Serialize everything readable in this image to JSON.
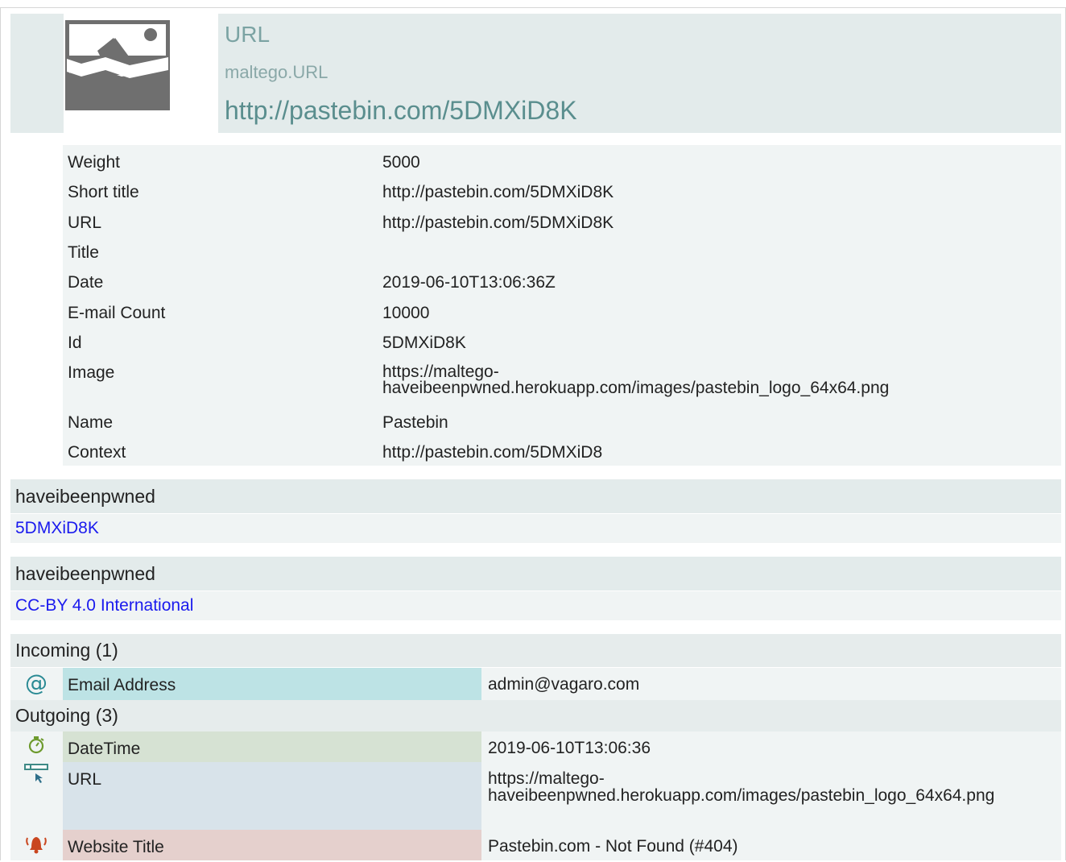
{
  "header": {
    "type_label": "URL",
    "type_id": "maltego.URL",
    "value": "http://pastebin.com/5DMXiD8K",
    "icon": "image-placeholder-icon"
  },
  "properties": [
    {
      "key": "Weight",
      "value": "5000"
    },
    {
      "key": "Short title",
      "value": "http://pastebin.com/5DMXiD8K"
    },
    {
      "key": "URL",
      "value": "http://pastebin.com/5DMXiD8K"
    },
    {
      "key": "Title",
      "value": ""
    },
    {
      "key": "Date",
      "value": "2019-06-10T13:06:36Z"
    },
    {
      "key": "E-mail Count",
      "value": "10000"
    },
    {
      "key": "Id",
      "value": "5DMXiD8K"
    },
    {
      "key": "Image",
      "value": "https://maltego-haveibeenpwned.herokuapp.com/images/pastebin_logo_64x64.png"
    },
    {
      "key": "Name",
      "value": "Pastebin"
    },
    {
      "key": "Context",
      "value": "http://pastebin.com/5DMXiD8"
    }
  ],
  "sections": [
    {
      "title": "haveibeenpwned",
      "link": "5DMXiD8K"
    },
    {
      "title": "haveibeenpwned",
      "link": "CC-BY 4.0 International"
    }
  ],
  "incoming": {
    "title": "Incoming (1)",
    "items": [
      {
        "type": "Email Address",
        "value": "admin@vagaro.com",
        "icon": "at-sign-icon",
        "color": "#bde3e5"
      }
    ]
  },
  "outgoing": {
    "title": "Outgoing (3)",
    "items": [
      {
        "type": "DateTime",
        "value": "2019-06-10T13:06:36",
        "icon": "stopwatch-icon",
        "color": "#d6e2d3"
      },
      {
        "type": "URL",
        "value": "https://maltego-haveibeenpwned.herokuapp.com/images/pastebin_logo_64x64.png",
        "icon": "url-cursor-icon",
        "color": "#d8e3ea"
      },
      {
        "type": "Website Title",
        "value": "Pastebin.com - Not Found (#404)",
        "icon": "alarm-bell-icon",
        "color": "#e5d0cd"
      }
    ]
  }
}
